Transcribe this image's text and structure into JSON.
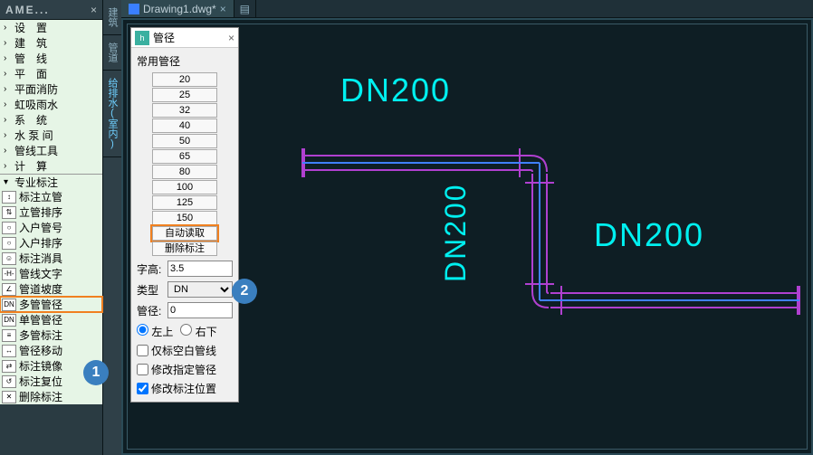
{
  "palette": {
    "title": "AME...",
    "tree": [
      "设　置",
      "建　筑",
      "管　线",
      "平　面",
      "平面消防",
      "虹吸雨水",
      "系　统",
      "水 泵 间",
      "管线工具",
      "计　算"
    ],
    "section": "专业标注",
    "items": [
      {
        "label": "标注立管",
        "icon": "↕"
      },
      {
        "label": "立管排序",
        "icon": "⇅"
      },
      {
        "label": "入户管号",
        "icon": "○"
      },
      {
        "label": "入户排序",
        "icon": "○"
      },
      {
        "label": "标注消具",
        "icon": "☺"
      },
      {
        "label": "管线文字",
        "icon": "-H-"
      },
      {
        "label": "管道坡度",
        "icon": "∠"
      },
      {
        "label": "多管管径",
        "icon": "DN",
        "hl": true
      },
      {
        "label": "单管管径",
        "icon": "DN"
      },
      {
        "label": "多管标注",
        "icon": "≡"
      },
      {
        "label": "管径移动",
        "icon": "↔"
      },
      {
        "label": "标注镜像",
        "icon": "⇄"
      },
      {
        "label": "标注复位",
        "icon": "↺"
      },
      {
        "label": "删除标注",
        "icon": "✕"
      }
    ]
  },
  "side_tabs": [
    "建筑",
    "管道",
    "给排水(室内)"
  ],
  "tab": {
    "name": "Drawing1.dwg*",
    "plus": "+"
  },
  "dialog": {
    "title": "管径",
    "group": "常用管径",
    "sizes": [
      "20",
      "25",
      "32",
      "40",
      "50",
      "65",
      "80",
      "100",
      "125",
      "150"
    ],
    "auto_read": "自动读取",
    "del_anno": "删除标注",
    "label_height": "字高:",
    "height_val": "3.5",
    "label_type": "类型",
    "type_val": "DN",
    "label_diam": "管径:",
    "diam_val": "0",
    "radio_lt": "左上",
    "radio_rb": "右下",
    "chk_blank": "仅标空白管线",
    "chk_modsel": "修改指定管径",
    "chk_modpos": "修改标注位置"
  },
  "canvas": {
    "label_top": "DN200",
    "label_mid": "DN200",
    "label_right": "DN200"
  },
  "badges": {
    "one": "1",
    "two": "2"
  }
}
